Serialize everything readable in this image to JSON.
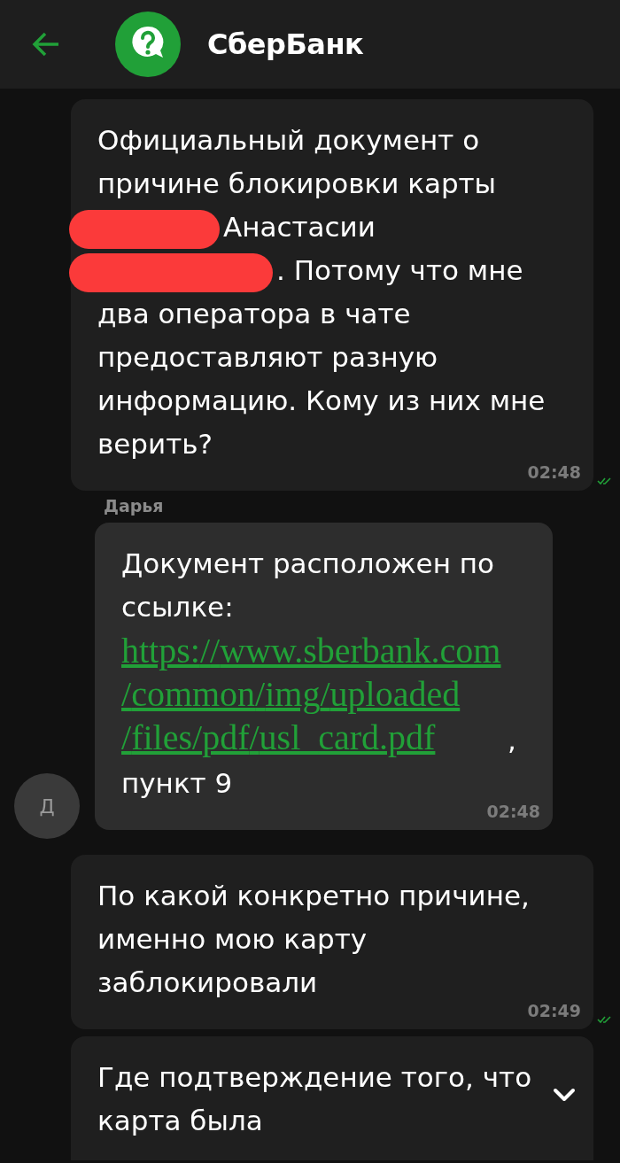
{
  "header": {
    "title": "СберБанк"
  },
  "messages": [
    {
      "kind": "outgoing",
      "segments": [
        {
          "kind": "text",
          "text": "Официальный документ о\nпричине блокировки карты\n"
        },
        {
          "kind": "redacted"
        },
        {
          "kind": "text",
          "text": "Анастасии\n"
        },
        {
          "kind": "redacted"
        },
        {
          "kind": "text",
          "text": ". Потому что мне\nдва оператора в чате\nпредоставляют разную\nинформацию. Кому из них мне\nверить?"
        }
      ],
      "time": "02:48",
      "read": true
    },
    {
      "kind": "incoming",
      "sender": "Дарья",
      "avatar": "Д",
      "segments": [
        {
          "kind": "text",
          "text": "Документ расположен по\nссылке: "
        },
        {
          "kind": "link",
          "text": "https://www.sberbank.com/common/img/uploaded/files/pdf/usl_card.pdf"
        },
        {
          "kind": "text",
          "text": ",\nпункт 9"
        }
      ],
      "time": "02:48"
    },
    {
      "kind": "outgoing",
      "segments": [
        {
          "kind": "text",
          "text": "По какой конкретно причине,\nименно мою карту\nзаблокировали"
        }
      ],
      "time": "02:49",
      "read": true
    },
    {
      "kind": "outgoing",
      "expandable": true,
      "segments": [
        {
          "kind": "text",
          "text": "Где подтверждение того, что\nкарта была"
        }
      ]
    }
  ]
}
